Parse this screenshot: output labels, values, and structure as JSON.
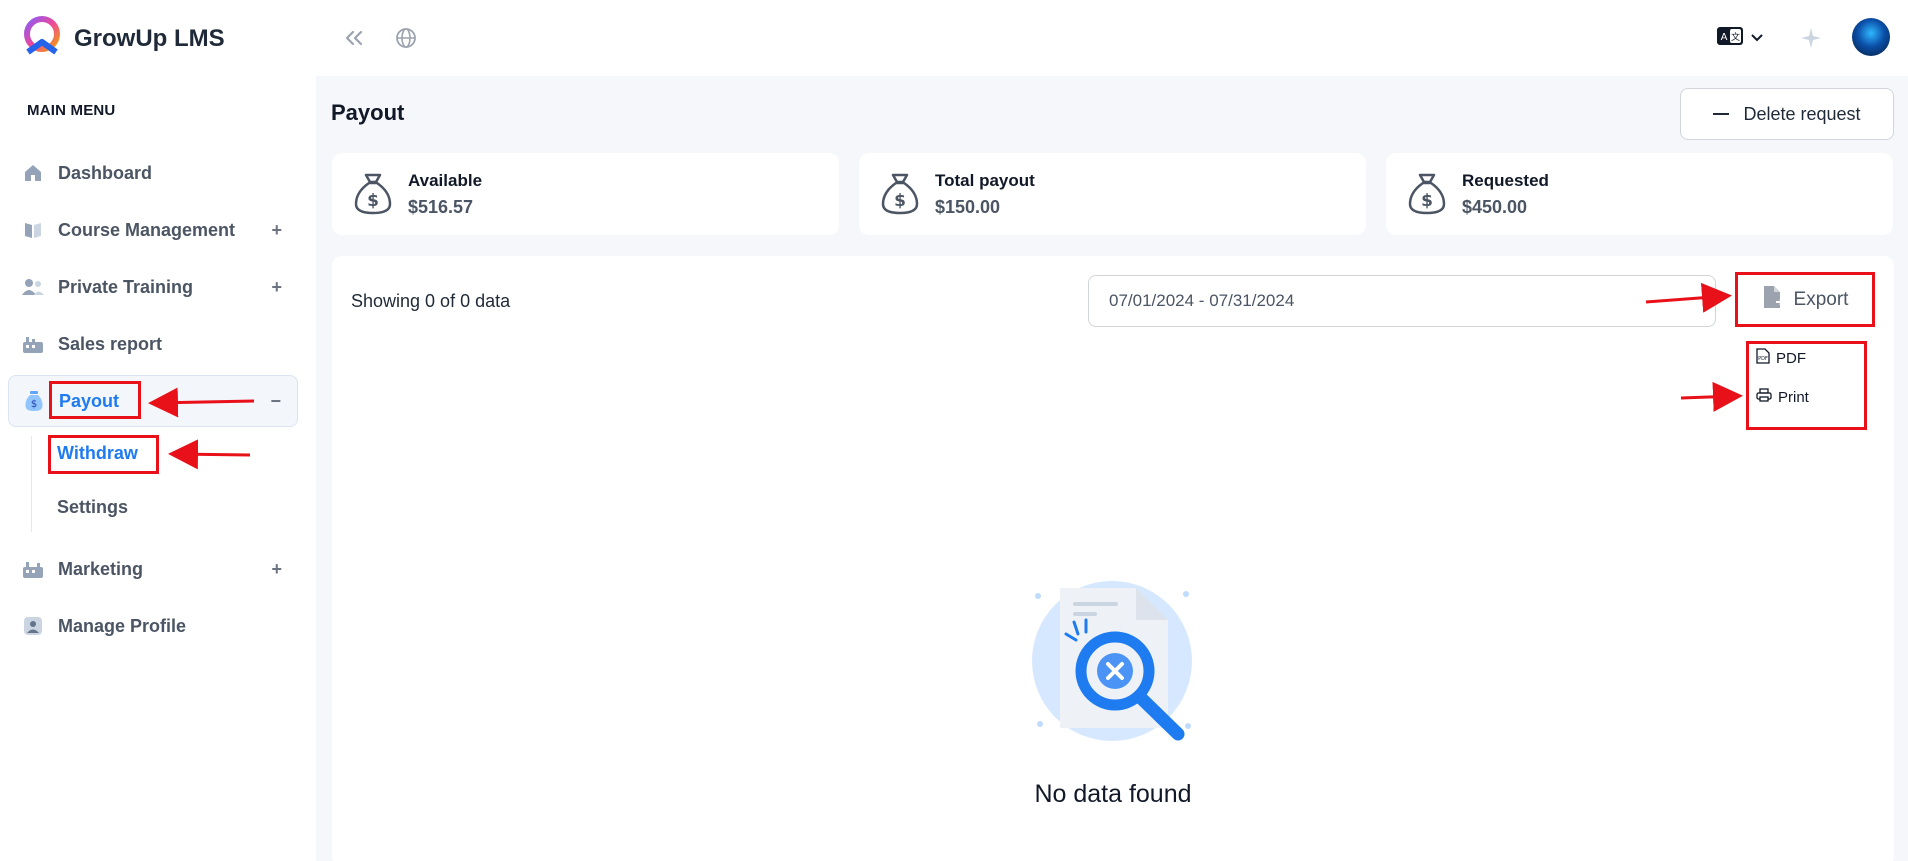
{
  "brand": {
    "name": "GrowUp LMS"
  },
  "sidebar": {
    "menu_title": "MAIN MENU",
    "items": [
      {
        "label": "Dashboard",
        "icon": "home-icon",
        "toggle": ""
      },
      {
        "label": "Course Management",
        "icon": "book-icon",
        "toggle": "+"
      },
      {
        "label": "Private Training",
        "icon": "users-icon",
        "toggle": "+"
      },
      {
        "label": "Sales report",
        "icon": "report-icon",
        "toggle": ""
      },
      {
        "label": "Payout",
        "icon": "moneybag-icon",
        "toggle": "−"
      },
      {
        "label": "Marketing",
        "icon": "marketing-icon",
        "toggle": "+"
      },
      {
        "label": "Manage Profile",
        "icon": "profile-icon",
        "toggle": ""
      }
    ],
    "payout_sub": [
      {
        "label": "Withdraw"
      },
      {
        "label": "Settings"
      }
    ]
  },
  "page": {
    "title": "Payout",
    "delete_button": "Delete request"
  },
  "cards": [
    {
      "label": "Available",
      "value": "$516.57"
    },
    {
      "label": "Total payout",
      "value": "$150.00"
    },
    {
      "label": "Requested",
      "value": "$450.00"
    }
  ],
  "table": {
    "showing": "Showing 0 of 0 data",
    "date_range": "07/01/2024 - 07/31/2024",
    "export_label": "Export",
    "export_options": [
      "PDF",
      "Print"
    ],
    "empty_text": "No data found"
  },
  "colors": {
    "accent": "#1e7bf0",
    "highlight": "#e8111a"
  }
}
